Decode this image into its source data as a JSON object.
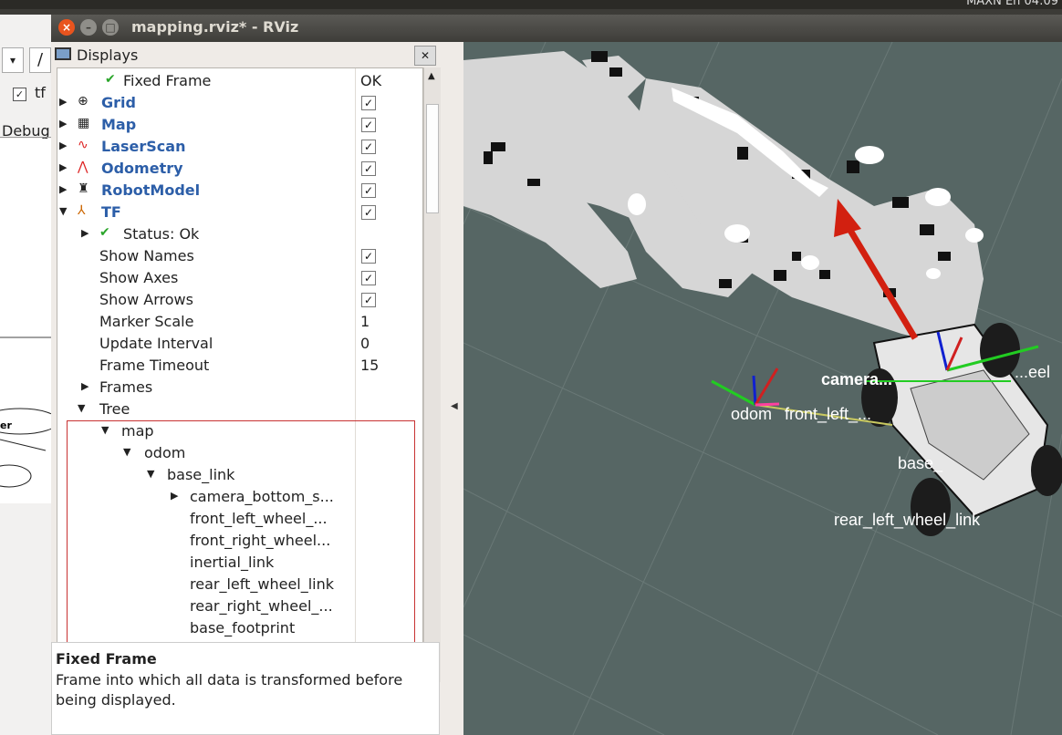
{
  "window": {
    "title": "mapping.rviz* - RViz"
  },
  "tray": {
    "text": "MAXN  En  04:09"
  },
  "background_app": {
    "combo": "▾",
    "slash": "/",
    "checkbox_label": "tf",
    "debug_label": "Debug"
  },
  "panel": {
    "title": "Displays",
    "rows": [
      {
        "label": "Fixed Frame",
        "value": "OK"
      },
      {
        "label": "Grid"
      },
      {
        "label": "Map"
      },
      {
        "label": "LaserScan"
      },
      {
        "label": "Odometry"
      },
      {
        "label": "RobotModel"
      },
      {
        "label": "TF"
      },
      {
        "label": "Status: Ok"
      },
      {
        "label": "Show Names"
      },
      {
        "label": "Show Axes"
      },
      {
        "label": "Show Arrows"
      },
      {
        "label": "Marker Scale",
        "value": "1"
      },
      {
        "label": "Update Interval",
        "value": "0"
      },
      {
        "label": "Frame Timeout",
        "value": "15"
      },
      {
        "label": "Frames"
      },
      {
        "label": "Tree"
      },
      {
        "label": "map"
      },
      {
        "label": "odom"
      },
      {
        "label": "base_link"
      },
      {
        "label": "camera_bottom_s..."
      },
      {
        "label": "front_left_wheel_..."
      },
      {
        "label": "front_right_wheel..."
      },
      {
        "label": "inertial_link"
      },
      {
        "label": "rear_left_wheel_link"
      },
      {
        "label": "rear_right_wheel_..."
      },
      {
        "label": "base_footprint"
      }
    ],
    "checkbox_states": [
      "✓",
      "✓",
      "✓",
      "✓",
      "✓",
      "✓",
      "✓",
      "✓",
      "✓"
    ]
  },
  "description": {
    "title": "Fixed Frame",
    "body": "Frame into which all data is transformed before being displayed."
  },
  "viewport": {
    "labels": {
      "odom": "odom",
      "front_left": "front_left_...",
      "camera": "camera...",
      "wheel": "...eel",
      "base": "base_",
      "rear_left": "rear_left_wheel_link"
    }
  },
  "colors": {
    "blue": "#2c5ea8",
    "viewport_bg": "#566664",
    "arrow_red": "#d22010"
  }
}
